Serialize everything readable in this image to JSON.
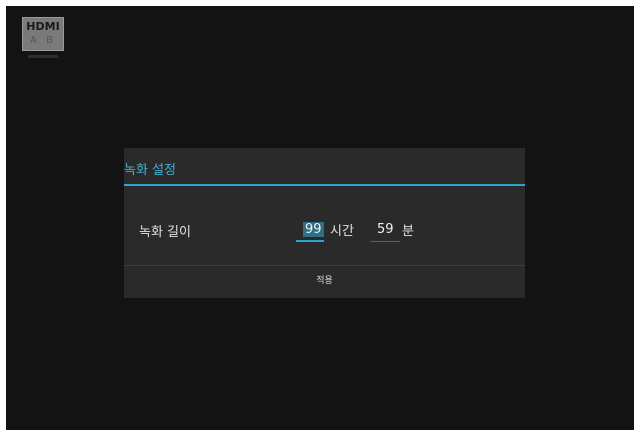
{
  "source_logo": {
    "text": "HDMI",
    "sub": "A B",
    "icon": "hdmi-input-icon"
  },
  "dialog": {
    "title": "녹화 설정",
    "row_label": "녹화 길이",
    "hours_value": "99",
    "hours_unit": "시간",
    "minutes_value": "59",
    "minutes_unit": "분",
    "apply_label": "적용"
  },
  "colors": {
    "background": "#131313",
    "dialog": "#2a2a2a",
    "accent": "#2ea6c9",
    "title_text": "#3db3d6",
    "text": "#e2e2e2"
  }
}
